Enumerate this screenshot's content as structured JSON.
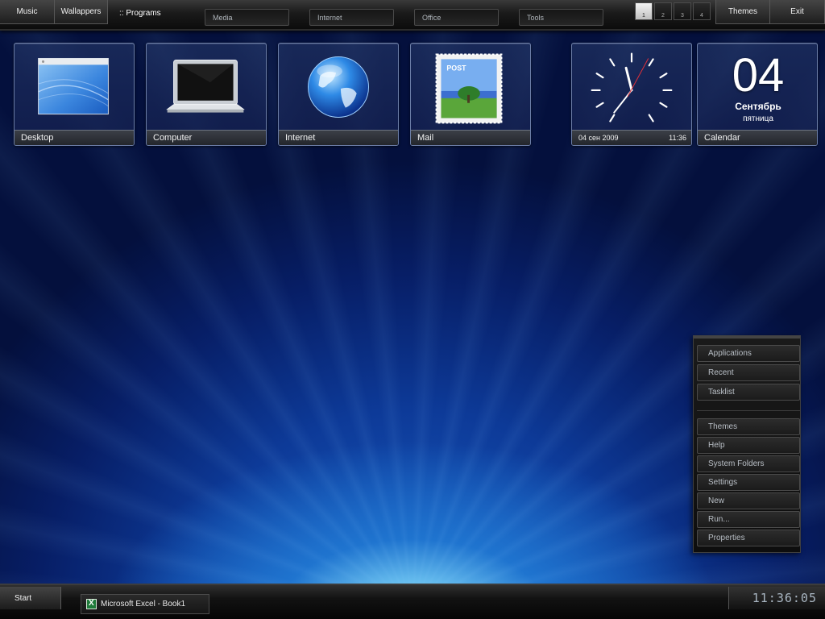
{
  "topbar": {
    "music": "Music",
    "wallpapers": "Wallappers",
    "programs": ":: Programs",
    "menus": [
      "Media",
      "Internet",
      "Office",
      "Tools"
    ],
    "desktops": [
      "1",
      "2",
      "3",
      "4"
    ],
    "themes": "Themes",
    "exit": "Exit"
  },
  "tiles": {
    "desktop": "Desktop",
    "computer": "Computer",
    "internet": "Internet",
    "mail": "Mail",
    "mail_stamp": "POST",
    "clock_date": "04 сен 2009",
    "clock_time": "11:36",
    "calendar": "Calendar",
    "cal_day": "04",
    "cal_month": "Сентябрь",
    "cal_weekday": "пятница"
  },
  "sidemenu": {
    "top": [
      "Applications",
      "Recent",
      "Tasklist"
    ],
    "bottom": [
      "Themes",
      "Help",
      "System Folders",
      "Settings",
      "New",
      "Run...",
      "Properties"
    ]
  },
  "bottombar": {
    "start": "Start",
    "task": "Microsoft Excel - Book1",
    "clock": "11:36:05"
  }
}
